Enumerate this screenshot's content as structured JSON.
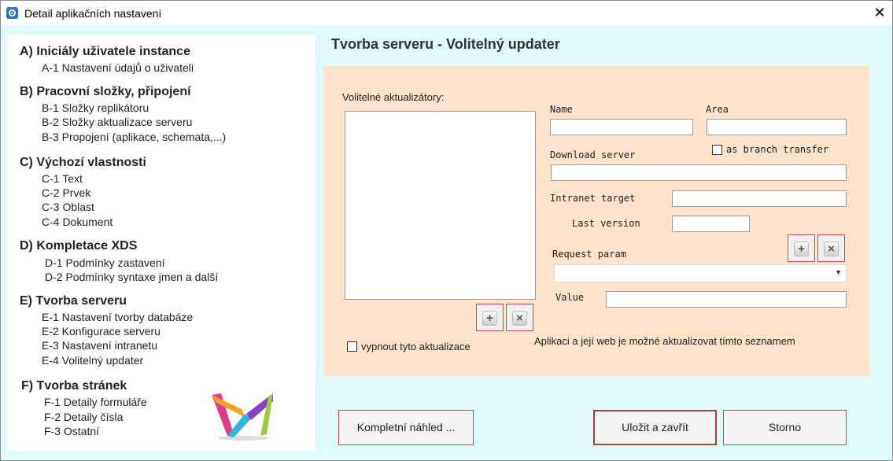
{
  "window": {
    "title": "Detail aplikačních nastavení"
  },
  "sidebar": {
    "sections": [
      {
        "title": "A) Iniciály uživatele instance",
        "items": [
          "A-1 Nastavení údajů o uživateli"
        ]
      },
      {
        "title": "B) Pracovní složky, připojení",
        "items": [
          "B-1 Složky replikátoru",
          "B-2 Složky aktualizace serveru",
          "B-3 Propojení (aplikace, schemata,...)"
        ]
      },
      {
        "title": "C) Výchozí vlastnosti",
        "items": [
          "C-1 Text",
          "C-2 Prvek",
          "C-3 Oblast",
          "C-4 Dokument"
        ]
      },
      {
        "title": "D) Kompletace XDS",
        "items": [
          "D-1 Podmínky zastavení",
          "D-2 Podmínky syntaxe jmen a další"
        ]
      },
      {
        "title": "E) Tvorba serveru",
        "items": [
          "E-1 Nastavení tvorby databáze",
          "E-2 Konfigurace serveru",
          "E-3 Nastavení intranetu",
          "E-4 Volitelný updater"
        ]
      },
      {
        "title": "F) Tvorba stránek",
        "items": [
          "F-1 Detaily formuláře",
          "F-2 Detaily čísla",
          "F-3 Ostatní"
        ]
      }
    ]
  },
  "main": {
    "title": "Tvorba serveru - Volitelný updater",
    "updaters_label": "Volitelné aktualizátory:",
    "disable_label": "vypnout tyto aktualizace",
    "disable_checked": false,
    "info_text": "Aplikaci a její web je možné aktualizovat tímto seznamem",
    "fields": {
      "name_label": "Name",
      "name_value": "",
      "area_label": "Area",
      "area_value": "",
      "branch_label": "as branch transfer",
      "branch_checked": false,
      "download_label": "Download server",
      "download_value": "",
      "intranet_label": "Intranet target",
      "intranet_value": "",
      "lastver_label": "Last version",
      "lastver_value": "",
      "reqparam_label": "Request param",
      "reqparam_value": "",
      "value_label": "Value",
      "value_value": ""
    },
    "icons": {
      "add": "+",
      "remove": "×"
    }
  },
  "buttons": {
    "preview": "Kompletní náhled ...",
    "save": "Uložit a zavřít",
    "cancel": "Storno"
  },
  "icons": {
    "close": "✕"
  },
  "colors": {
    "panel": "#fde3cc",
    "background": "#dffafd",
    "button_border": "#c0504d"
  }
}
